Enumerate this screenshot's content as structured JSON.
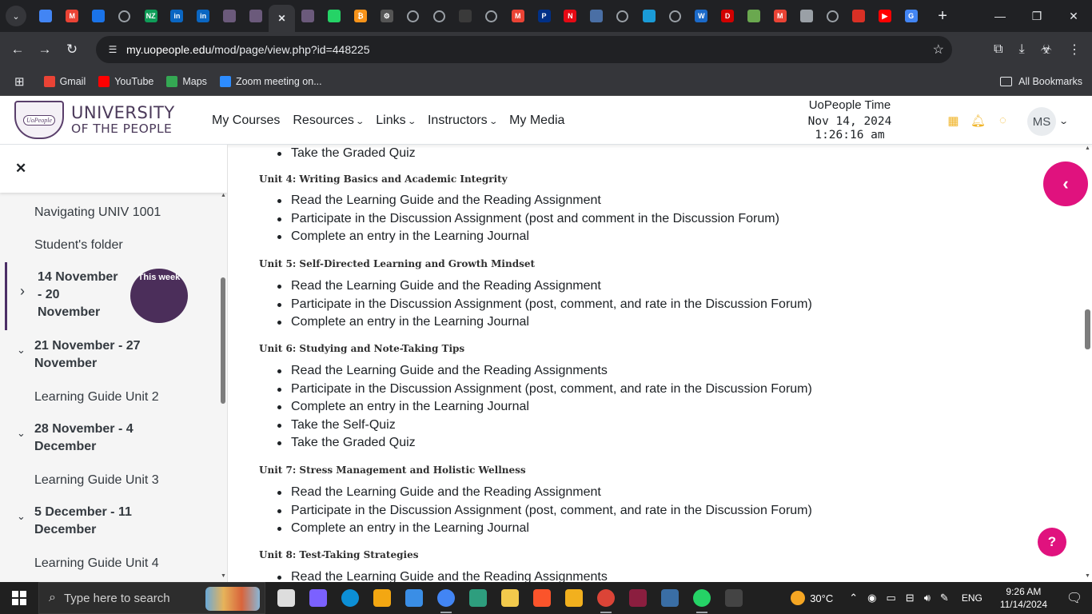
{
  "browser": {
    "tabs": [
      {
        "icon": "docs-icon",
        "color": "#4285f4",
        "letter": ""
      },
      {
        "icon": "gmail-icon",
        "color": "#ea4335",
        "letter": "M"
      },
      {
        "icon": "arrow-up-icon",
        "color": "#1a73e8",
        "letter": ""
      },
      {
        "icon": "globe-icon",
        "color": "",
        "letter": ""
      },
      {
        "icon": "nz-icon",
        "color": "#0f9d58",
        "letter": "NZ"
      },
      {
        "icon": "linkedin-icon",
        "color": "#0a66c2",
        "letter": "in"
      },
      {
        "icon": "linkedin-icon",
        "color": "#0a66c2",
        "letter": "in"
      },
      {
        "icon": "uopeople-icon",
        "color": "#6b5a7b",
        "letter": ""
      },
      {
        "icon": "uopeople-icon",
        "color": "#6b5a7b",
        "letter": ""
      },
      {
        "icon": "close-icon",
        "color": "",
        "letter": "✕",
        "active": true
      },
      {
        "icon": "uopeople-icon",
        "color": "#6b5a7b",
        "letter": ""
      },
      {
        "icon": "whatsapp-icon",
        "color": "#25d366",
        "letter": ""
      },
      {
        "icon": "bitcoin-icon",
        "color": "#f7931a",
        "letter": "₿"
      },
      {
        "icon": "openai-icon",
        "color": "#555",
        "letter": "⚙"
      },
      {
        "icon": "globe-icon",
        "color": "",
        "letter": ""
      },
      {
        "icon": "globe-icon",
        "color": "",
        "letter": ""
      },
      {
        "icon": "blank-icon",
        "color": "#3a3a3a",
        "letter": ""
      },
      {
        "icon": "globe-icon",
        "color": "",
        "letter": ""
      },
      {
        "icon": "gmail-icon",
        "color": "#ea4335",
        "letter": "M"
      },
      {
        "icon": "paypal-icon",
        "color": "#003087",
        "letter": "P"
      },
      {
        "icon": "netflix-icon",
        "color": "#e50914",
        "letter": "N"
      },
      {
        "icon": "app-icon",
        "color": "#4a6fa5",
        "letter": ""
      },
      {
        "icon": "globe-icon",
        "color": "",
        "letter": ""
      },
      {
        "icon": "link-icon",
        "color": "#1a9bd7",
        "letter": ""
      },
      {
        "icon": "globe-icon",
        "color": "",
        "letter": ""
      },
      {
        "icon": "webex-icon",
        "color": "#1b6ac9",
        "letter": "W"
      },
      {
        "icon": "d-icon",
        "color": "#d10000",
        "letter": "D"
      },
      {
        "icon": "pen-icon",
        "color": "#6aa84f",
        "letter": ""
      },
      {
        "icon": "gmail-icon",
        "color": "#ea4335",
        "letter": "M"
      },
      {
        "icon": "ghost-icon",
        "color": "#9aa0a6",
        "letter": ""
      },
      {
        "icon": "globe-icon",
        "color": "",
        "letter": ""
      },
      {
        "icon": "speed-icon",
        "color": "#d93025",
        "letter": ""
      },
      {
        "icon": "youtube-icon",
        "color": "#ff0000",
        "letter": "▶"
      },
      {
        "icon": "google-icon",
        "color": "#4285f4",
        "letter": "G"
      }
    ],
    "url_host": "my.uopeople.edu",
    "url_path": "/mod/page/view.php?id=448225",
    "bookmarks": [
      {
        "label": "Gmail",
        "icon": "gmail-icon",
        "color": "#ea4335"
      },
      {
        "label": "YouTube",
        "icon": "youtube-icon",
        "color": "#ff0000"
      },
      {
        "label": "Maps",
        "icon": "maps-icon",
        "color": "#34a853"
      },
      {
        "label": "Zoom meeting on...",
        "icon": "zoom-icon",
        "color": "#2d8cff"
      }
    ],
    "all_bookmarks": "All Bookmarks"
  },
  "header": {
    "logo_line1": "UNIVERSITY",
    "logo_line2": "OF THE PEOPLE",
    "logo_badge": "UoPeople",
    "nav": [
      {
        "label": "My Courses",
        "dropdown": false
      },
      {
        "label": "Resources",
        "dropdown": true
      },
      {
        "label": "Links",
        "dropdown": true
      },
      {
        "label": "Instructors",
        "dropdown": true
      },
      {
        "label": "My Media",
        "dropdown": false
      }
    ],
    "clock_title": "UoPeople Time",
    "clock_date": "Nov 14, 2024",
    "clock_time": "1:26:16 am",
    "user_initials": "MS"
  },
  "drawer": {
    "items": [
      {
        "label": "Navigating UNIV 1001",
        "type": "item"
      },
      {
        "label": "Student's folder",
        "type": "item"
      },
      {
        "label": "14 November - 20 November",
        "type": "section",
        "current": true,
        "expanded": false
      },
      {
        "label": "21 November - 27 November",
        "type": "section",
        "expanded": true
      },
      {
        "label": "Learning Guide Unit 2",
        "type": "item"
      },
      {
        "label": "28 November - 4 December",
        "type": "section",
        "expanded": true
      },
      {
        "label": "Learning Guide Unit 3",
        "type": "item"
      },
      {
        "label": "5 December - 11 December",
        "type": "section",
        "expanded": true
      },
      {
        "label": "Learning Guide Unit 4",
        "type": "item"
      }
    ],
    "badge": "This week"
  },
  "content": {
    "top_item": "Take the Graded Quiz",
    "units": [
      {
        "title": "Unit 4: Writing Basics and Academic Integrity",
        "items": [
          "Read the Learning Guide and the Reading Assignment",
          "Participate in the Discussion Assignment (post and comment in the Discussion Forum)",
          "Complete an entry in the Learning Journal"
        ]
      },
      {
        "title": "Unit 5: Self-Directed Learning and Growth Mindset",
        "items": [
          "Read the Learning Guide and the Reading Assignment",
          "Participate in the Discussion Assignment (post, comment, and rate in the Discussion Forum)",
          "Complete an entry in the Learning Journal"
        ]
      },
      {
        "title": "Unit 6: Studying and Note-Taking Tips",
        "items": [
          "Read the Learning Guide and the Reading Assignments",
          "Participate in the Discussion Assignment (post, comment, and rate in the Discussion Forum)",
          "Complete an entry in the Learning Journal",
          "Take the Self-Quiz",
          "Take the Graded Quiz"
        ]
      },
      {
        "title": "Unit 7: Stress Management and Holistic Wellness",
        "items": [
          "Read the Learning Guide and the Reading Assignment",
          "Participate in the Discussion Assignment (post, comment, and rate in the Discussion Forum)",
          "Complete an entry in the Learning Journal"
        ]
      },
      {
        "title": "Unit 8: Test-Taking Strategies",
        "items": [
          "Read the Learning Guide and the Reading Assignments"
        ]
      }
    ]
  },
  "taskbar": {
    "search_placeholder": "Type here to search",
    "weather": "30°C",
    "language": "ENG",
    "time": "9:26 AM",
    "date": "11/14/2024",
    "apps": [
      {
        "icon": "task-view-icon",
        "color": "#ddd"
      },
      {
        "icon": "copilot-icon",
        "color": "#7b61ff"
      },
      {
        "icon": "edge-icon",
        "color": "#0c8fd6"
      },
      {
        "icon": "store-icon",
        "color": "#f3a712"
      },
      {
        "icon": "mail-icon",
        "color": "#3a8ee6"
      },
      {
        "icon": "chrome-icon",
        "color": "#4285f4",
        "open": true
      },
      {
        "icon": "app-icon",
        "color": "#2e9e7e"
      },
      {
        "icon": "explorer-icon",
        "color": "#f2c94c"
      },
      {
        "icon": "brave-icon",
        "color": "#fb542b"
      },
      {
        "icon": "app-icon",
        "color": "#f2b01e"
      },
      {
        "icon": "chrome-icon",
        "color": "#db4437",
        "open": true
      },
      {
        "icon": "winrar-icon",
        "color": "#8b1e3f"
      },
      {
        "icon": "app-icon",
        "color": "#3a6ea5"
      },
      {
        "icon": "whatsapp-icon",
        "color": "#25d366",
        "open": true
      },
      {
        "icon": "terminal-icon",
        "color": "#444"
      }
    ]
  }
}
